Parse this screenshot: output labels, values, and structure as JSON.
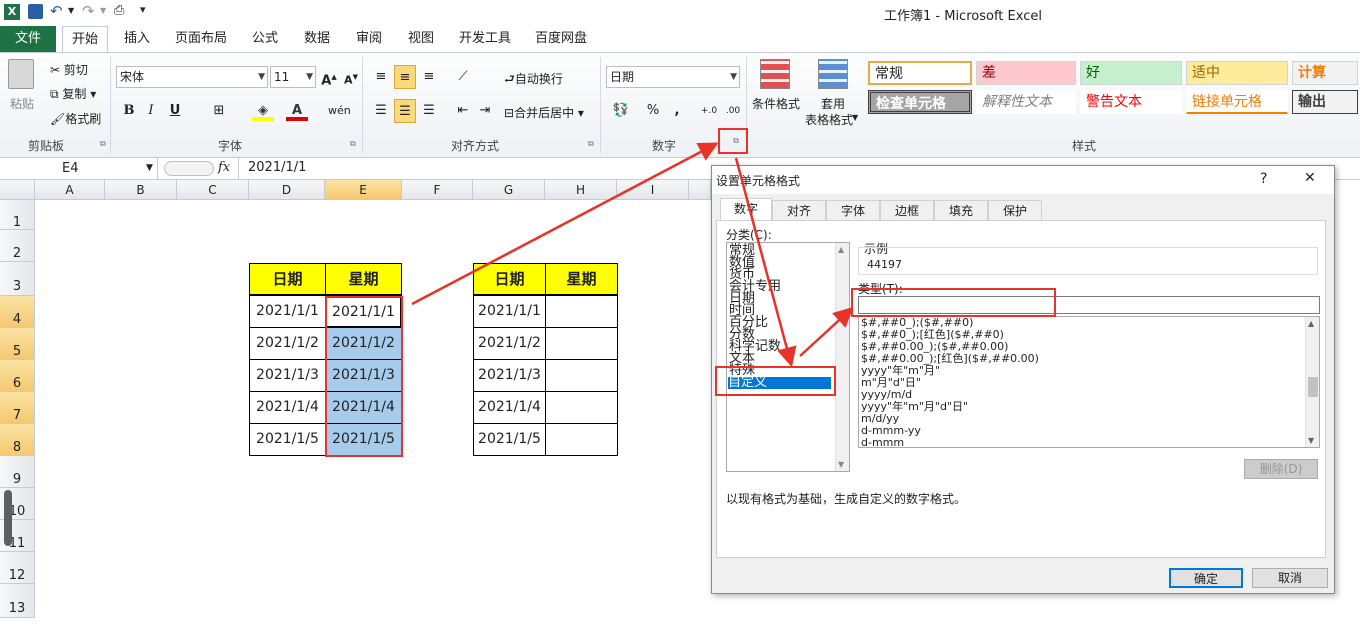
{
  "app": {
    "title": "工作簿1 - Microsoft Excel"
  },
  "tabs": [
    {
      "label": "文件"
    },
    {
      "label": "开始"
    },
    {
      "label": "插入"
    },
    {
      "label": "页面布局"
    },
    {
      "label": "公式"
    },
    {
      "label": "数据"
    },
    {
      "label": "审阅"
    },
    {
      "label": "视图"
    },
    {
      "label": "开发工具"
    },
    {
      "label": "百度网盘"
    }
  ],
  "ribbon": {
    "clipboard": {
      "paste": "粘贴",
      "cut": "剪切",
      "copy": "复制",
      "format_painter": "格式刷",
      "label": "剪贴板"
    },
    "font": {
      "name": "宋体",
      "size": "11",
      "label": "字体",
      "bold": "B",
      "italic": "I",
      "underline": "U"
    },
    "alignment": {
      "wrap": "自动换行",
      "merge": "合并后居中",
      "label": "对齐方式"
    },
    "number": {
      "format": "日期",
      "label": "数字",
      "percent": "%",
      "comma": ","
    },
    "styles_group": {
      "conditional": "条件格式",
      "table_line1": "套用",
      "table_line2": "表格格式",
      "label": "样式"
    },
    "styles": [
      {
        "label": "常规"
      },
      {
        "label": "差"
      },
      {
        "label": "好"
      },
      {
        "label": "适中"
      },
      {
        "label": "计算"
      },
      {
        "label": "检查单元格"
      },
      {
        "label": "解释性文本"
      },
      {
        "label": "警告文本"
      },
      {
        "label": "链接单元格"
      },
      {
        "label": "输出"
      }
    ]
  },
  "formula_bar": {
    "name_box": "E4",
    "fx": "fx",
    "value": "2021/1/1"
  },
  "columns": [
    "A",
    "B",
    "C",
    "D",
    "E",
    "F",
    "G",
    "H",
    "I"
  ],
  "rows": [
    "1",
    "2",
    "3",
    "4",
    "5",
    "6",
    "7",
    "8",
    "9",
    "10",
    "11",
    "12",
    "13"
  ],
  "table1": {
    "headers": [
      "日期",
      "星期"
    ],
    "rows": [
      [
        "2021/1/1",
        "2021/1/1"
      ],
      [
        "2021/1/2",
        "2021/1/2"
      ],
      [
        "2021/1/3",
        "2021/1/3"
      ],
      [
        "2021/1/4",
        "2021/1/4"
      ],
      [
        "2021/1/5",
        "2021/1/5"
      ]
    ]
  },
  "table2": {
    "headers": [
      "日期",
      "星期"
    ],
    "rows": [
      [
        "2021/1/1",
        ""
      ],
      [
        "2021/1/2",
        ""
      ],
      [
        "2021/1/3",
        ""
      ],
      [
        "2021/1/4",
        ""
      ],
      [
        "2021/1/5",
        ""
      ]
    ]
  },
  "dialog": {
    "title": "设置单元格格式",
    "help": "?",
    "close": "✕",
    "tabs": [
      {
        "label": "数字"
      },
      {
        "label": "对齐"
      },
      {
        "label": "字体"
      },
      {
        "label": "边框"
      },
      {
        "label": "填充"
      },
      {
        "label": "保护"
      }
    ],
    "category_label": "分类(C):",
    "categories": [
      "常规",
      "数值",
      "货币",
      "会计专用",
      "日期",
      "时间",
      "百分比",
      "分数",
      "科学记数",
      "文本",
      "特殊",
      "自定义"
    ],
    "selected_category": "自定义",
    "sample_label": "示例",
    "sample_value": "44197",
    "type_label": "类型(T):",
    "type_value": "",
    "formats": [
      "$#,##0_);($#,##0)",
      "$#,##0_);[红色]($#,##0)",
      "$#,##0.00_);($#,##0.00)",
      "$#,##0.00_);[红色]($#,##0.00)",
      "yyyy\"年\"m\"月\"",
      "m\"月\"d\"日\"",
      "yyyy/m/d",
      "yyyy\"年\"m\"月\"d\"日\"",
      "m/d/yy",
      "d-mmm-yy",
      "d-mmm"
    ],
    "delete_button": "删除(D)",
    "description": "以现有格式为基础，生成自定义的数字格式。",
    "ok": "确定",
    "cancel": "取消"
  },
  "colors": {
    "excel_green": "#1e7145",
    "selection_blue": "#a7cbeb",
    "header_yellow": "#ffff00",
    "annotation_red": "#e8332b"
  }
}
